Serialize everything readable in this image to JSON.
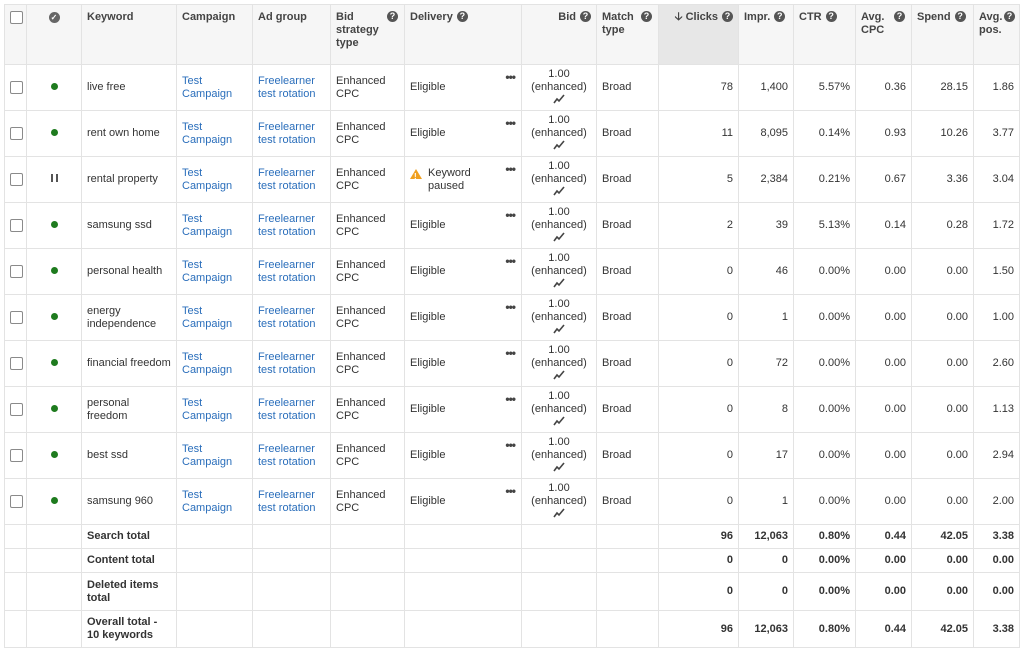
{
  "headers": {
    "keyword": "Keyword",
    "campaign": "Campaign",
    "ad_group": "Ad group",
    "bid_strategy": "Bid strategy type",
    "delivery": "Delivery",
    "bid": "Bid",
    "match_type": "Match type",
    "clicks": "Clicks",
    "impr": "Impr.",
    "ctr": "CTR",
    "avg_cpc": "Avg. CPC",
    "spend": "Spend",
    "avg_pos": "Avg. pos."
  },
  "rows": [
    {
      "status": "active",
      "keyword": "live free",
      "campaign": "Test Campaign",
      "ad_group": "Freelearner test rotation",
      "strategy": "Enhanced CPC",
      "delivery": "Eligible",
      "delivery_warning": false,
      "bid_value": "1.00",
      "bid_note": "(enhanced)",
      "match": "Broad",
      "clicks": "78",
      "impr": "1,400",
      "ctr": "5.57%",
      "avg_cpc": "0.36",
      "spend": "28.15",
      "avg_pos": "1.86"
    },
    {
      "status": "active",
      "keyword": "rent own home",
      "campaign": "Test Campaign",
      "ad_group": "Freelearner test rotation",
      "strategy": "Enhanced CPC",
      "delivery": "Eligible",
      "delivery_warning": false,
      "bid_value": "1.00",
      "bid_note": "(enhanced)",
      "match": "Broad",
      "clicks": "11",
      "impr": "8,095",
      "ctr": "0.14%",
      "avg_cpc": "0.93",
      "spend": "10.26",
      "avg_pos": "3.77"
    },
    {
      "status": "paused",
      "keyword": "rental property",
      "campaign": "Test Campaign",
      "ad_group": "Freelearner test rotation",
      "strategy": "Enhanced CPC",
      "delivery": "Keyword paused",
      "delivery_warning": true,
      "bid_value": "1.00",
      "bid_note": "(enhanced)",
      "match": "Broad",
      "clicks": "5",
      "impr": "2,384",
      "ctr": "0.21%",
      "avg_cpc": "0.67",
      "spend": "3.36",
      "avg_pos": "3.04"
    },
    {
      "status": "active",
      "keyword": "samsung ssd",
      "campaign": "Test Campaign",
      "ad_group": "Freelearner test rotation",
      "strategy": "Enhanced CPC",
      "delivery": "Eligible",
      "delivery_warning": false,
      "bid_value": "1.00",
      "bid_note": "(enhanced)",
      "match": "Broad",
      "clicks": "2",
      "impr": "39",
      "ctr": "5.13%",
      "avg_cpc": "0.14",
      "spend": "0.28",
      "avg_pos": "1.72"
    },
    {
      "status": "active",
      "keyword": "personal health",
      "campaign": "Test Campaign",
      "ad_group": "Freelearner test rotation",
      "strategy": "Enhanced CPC",
      "delivery": "Eligible",
      "delivery_warning": false,
      "bid_value": "1.00",
      "bid_note": "(enhanced)",
      "match": "Broad",
      "clicks": "0",
      "impr": "46",
      "ctr": "0.00%",
      "avg_cpc": "0.00",
      "spend": "0.00",
      "avg_pos": "1.50"
    },
    {
      "status": "active",
      "keyword": "energy independence",
      "campaign": "Test Campaign",
      "ad_group": "Freelearner test rotation",
      "strategy": "Enhanced CPC",
      "delivery": "Eligible",
      "delivery_warning": false,
      "bid_value": "1.00",
      "bid_note": "(enhanced)",
      "match": "Broad",
      "clicks": "0",
      "impr": "1",
      "ctr": "0.00%",
      "avg_cpc": "0.00",
      "spend": "0.00",
      "avg_pos": "1.00"
    },
    {
      "status": "active",
      "keyword": "financial freedom",
      "campaign": "Test Campaign",
      "ad_group": "Freelearner test rotation",
      "strategy": "Enhanced CPC",
      "delivery": "Eligible",
      "delivery_warning": false,
      "bid_value": "1.00",
      "bid_note": "(enhanced)",
      "match": "Broad",
      "clicks": "0",
      "impr": "72",
      "ctr": "0.00%",
      "avg_cpc": "0.00",
      "spend": "0.00",
      "avg_pos": "2.60"
    },
    {
      "status": "active",
      "keyword": "personal freedom",
      "campaign": "Test Campaign",
      "ad_group": "Freelearner test rotation",
      "strategy": "Enhanced CPC",
      "delivery": "Eligible",
      "delivery_warning": false,
      "bid_value": "1.00",
      "bid_note": "(enhanced)",
      "match": "Broad",
      "clicks": "0",
      "impr": "8",
      "ctr": "0.00%",
      "avg_cpc": "0.00",
      "spend": "0.00",
      "avg_pos": "1.13"
    },
    {
      "status": "active",
      "keyword": "best ssd",
      "campaign": "Test Campaign",
      "ad_group": "Freelearner test rotation",
      "strategy": "Enhanced CPC",
      "delivery": "Eligible",
      "delivery_warning": false,
      "bid_value": "1.00",
      "bid_note": "(enhanced)",
      "match": "Broad",
      "clicks": "0",
      "impr": "17",
      "ctr": "0.00%",
      "avg_cpc": "0.00",
      "spend": "0.00",
      "avg_pos": "2.94"
    },
    {
      "status": "active",
      "keyword": "samsung 960",
      "campaign": "Test Campaign",
      "ad_group": "Freelearner test rotation",
      "strategy": "Enhanced CPC",
      "delivery": "Eligible",
      "delivery_warning": false,
      "bid_value": "1.00",
      "bid_note": "(enhanced)",
      "match": "Broad",
      "clicks": "0",
      "impr": "1",
      "ctr": "0.00%",
      "avg_cpc": "0.00",
      "spend": "0.00",
      "avg_pos": "2.00"
    }
  ],
  "totals": [
    {
      "label": "Search total",
      "clicks": "96",
      "impr": "12,063",
      "ctr": "0.80%",
      "avg_cpc": "0.44",
      "spend": "42.05",
      "avg_pos": "3.38"
    },
    {
      "label": "Content total",
      "clicks": "0",
      "impr": "0",
      "ctr": "0.00%",
      "avg_cpc": "0.00",
      "spend": "0.00",
      "avg_pos": "0.00"
    },
    {
      "label": "Deleted items total",
      "clicks": "0",
      "impr": "0",
      "ctr": "0.00%",
      "avg_cpc": "0.00",
      "spend": "0.00",
      "avg_pos": "0.00"
    },
    {
      "label": "Overall total - 10 keywords",
      "clicks": "96",
      "impr": "12,063",
      "ctr": "0.80%",
      "avg_cpc": "0.44",
      "spend": "42.05",
      "avg_pos": "3.38"
    }
  ],
  "colors": {
    "active_dot": "#1e7b1e",
    "warning": "#f0a020",
    "link": "#2a6ebb"
  },
  "icons": {
    "status_header": "check-circle-icon",
    "help": "help-icon",
    "sort": "arrow-down-icon",
    "more": "ellipsis-icon",
    "trend": "trend-icon",
    "warning": "warning-icon"
  }
}
